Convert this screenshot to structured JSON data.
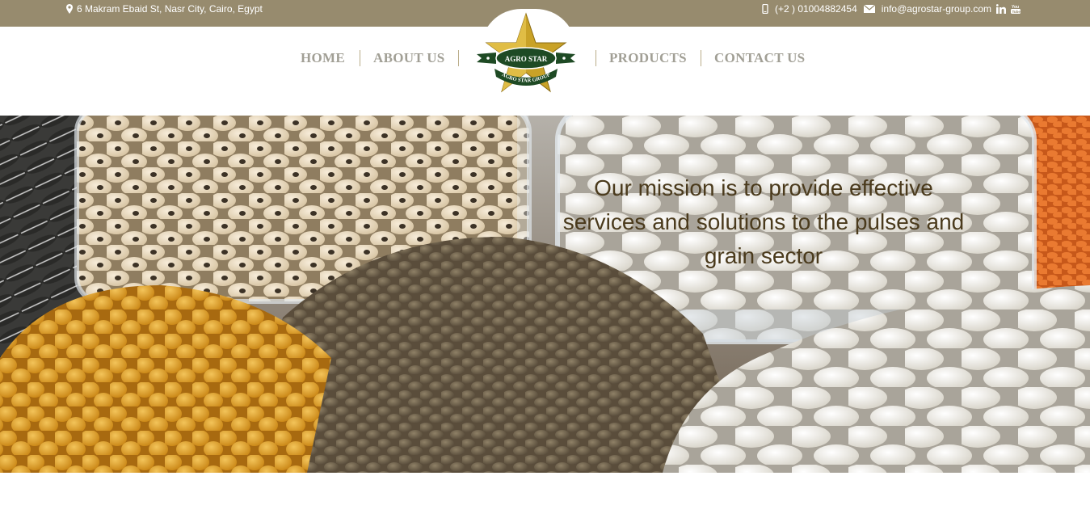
{
  "topbar": {
    "address": "6 Makram Ebaid St, Nasr City, Cairo, Egypt",
    "phone": "(+2 ) 01004882454",
    "email": "info@agrostar-group.com",
    "icons": [
      "map-pin-icon",
      "phone-icon",
      "mail-icon",
      "linkedin-icon",
      "youtube-icon"
    ]
  },
  "nav": {
    "home": "HOME",
    "about": "ABOUT US",
    "products": "PRODUCTS",
    "contact": "CONTACT US"
  },
  "logo": {
    "top_text": "AGRO STAR",
    "bottom_text": "AGRO STAR GROUP"
  },
  "hero": {
    "mission": "Our mission is to provide effective services and solutions to the pulses and grain sector"
  },
  "colors": {
    "topbar_bg": "#978b6e",
    "nav_text": "#a19f95",
    "separator": "#b9ac88",
    "logo_green": "#1e4a24",
    "logo_gold": "#c9a227",
    "mission_text": "#4a3a1c"
  }
}
